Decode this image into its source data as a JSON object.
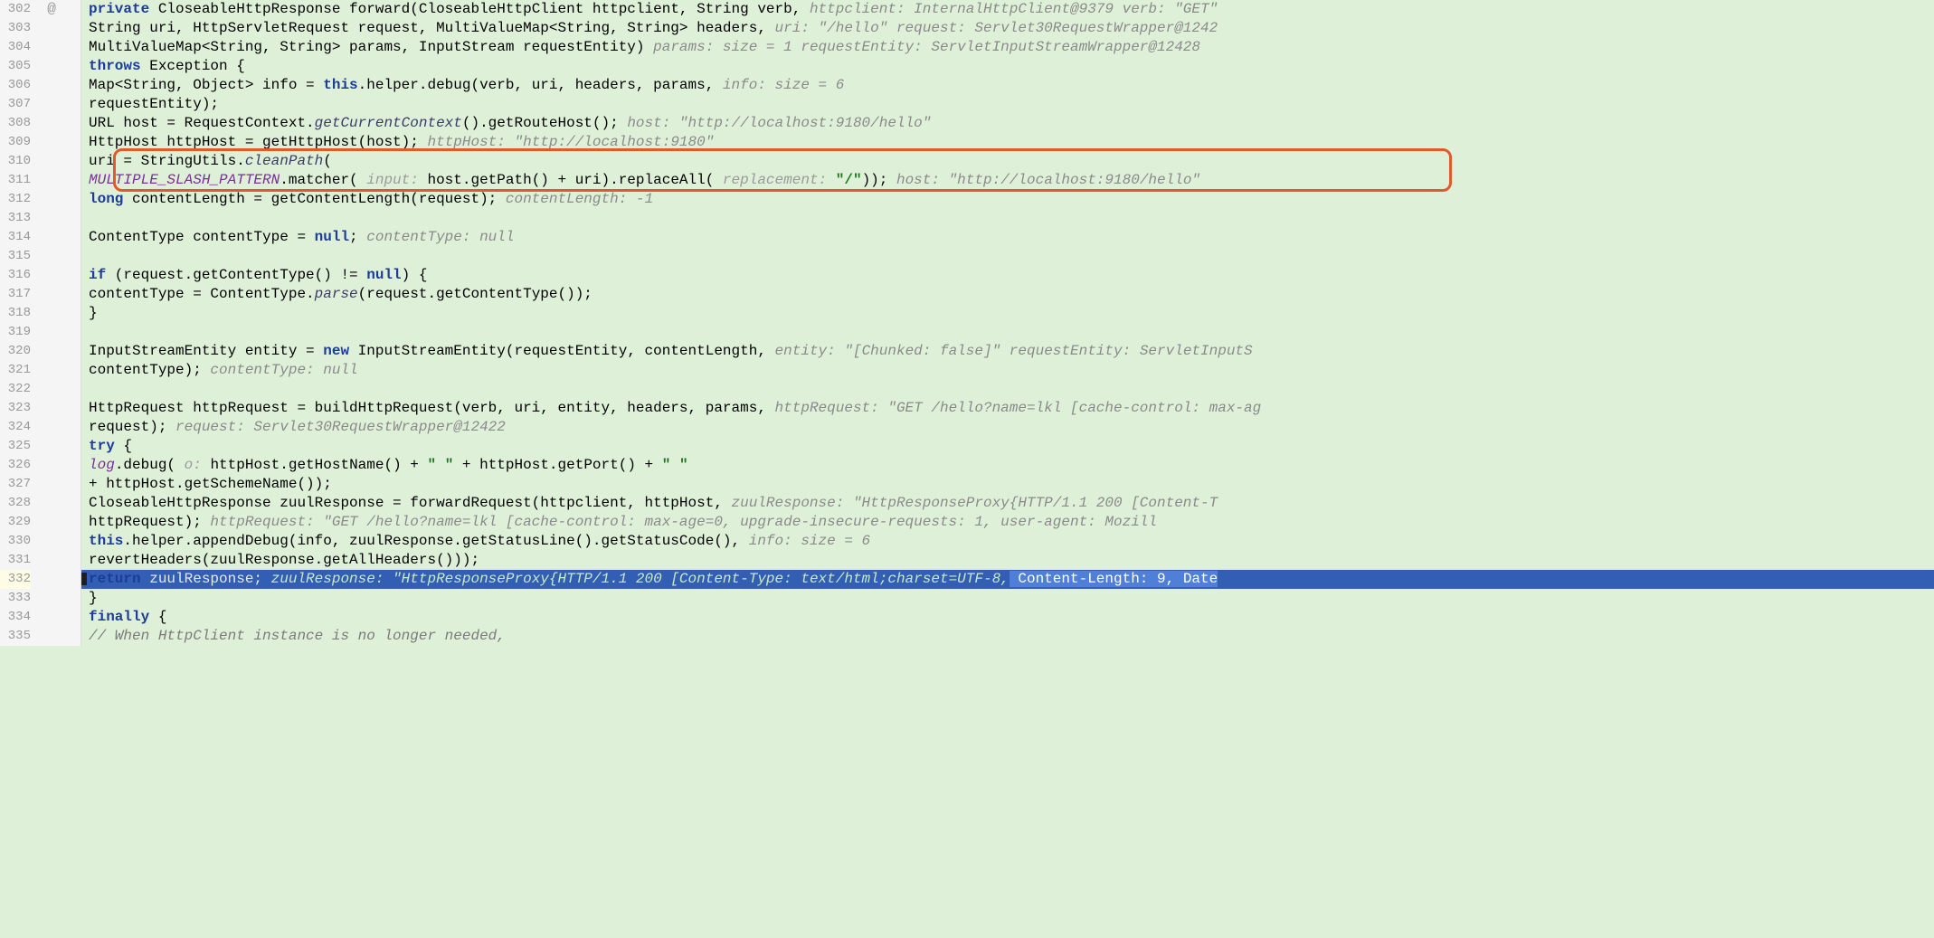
{
  "lines": [
    {
      "n": "302",
      "anno": "@",
      "code": [
        {
          "t": "    ",
          "c": ""
        },
        {
          "t": "private",
          "c": "kw"
        },
        {
          "t": " CloseableHttpResponse forward(CloseableHttpClient httpclient, String verb,   ",
          "c": ""
        },
        {
          "t": "httpclient: InternalHttpClient@9379  verb: \"GET\"",
          "c": "hint"
        }
      ]
    },
    {
      "n": "303",
      "code": [
        {
          "t": "            String uri, HttpServletRequest request, MultiValueMap<String, String> headers,  ",
          "c": ""
        },
        {
          "t": "uri: \"/hello\"  request: Servlet30RequestWrapper@1242",
          "c": "hint"
        }
      ]
    },
    {
      "n": "304",
      "code": [
        {
          "t": "            MultiValueMap<String, String> params, InputStream requestEntity)   ",
          "c": ""
        },
        {
          "t": "params:  size = 1  requestEntity: ServletInputStreamWrapper@12428",
          "c": "hint"
        }
      ]
    },
    {
      "n": "305",
      "code": [
        {
          "t": "            ",
          "c": ""
        },
        {
          "t": "throws",
          "c": "kw"
        },
        {
          "t": " Exception {",
          "c": ""
        }
      ]
    },
    {
      "n": "306",
      "code": [
        {
          "t": "        Map<String, Object> info = ",
          "c": ""
        },
        {
          "t": "this",
          "c": "kw"
        },
        {
          "t": ".helper.debug(verb, uri, headers, params,   ",
          "c": ""
        },
        {
          "t": "info:  size = 6",
          "c": "hint"
        }
      ]
    },
    {
      "n": "307",
      "code": [
        {
          "t": "                requestEntity);",
          "c": ""
        }
      ]
    },
    {
      "n": "308",
      "code": [
        {
          "t": "        URL host = RequestContext.",
          "c": ""
        },
        {
          "t": "getCurrentContext",
          "c": "method-call"
        },
        {
          "t": "().getRouteHost();   ",
          "c": ""
        },
        {
          "t": "host: \"http://localhost:9180/hello\"",
          "c": "hint"
        }
      ]
    },
    {
      "n": "309",
      "code": [
        {
          "t": "        HttpHost httpHost = getHttpHost(host);   ",
          "c": ""
        },
        {
          "t": "httpHost: \"http://localhost:9180\"",
          "c": "hint"
        }
      ]
    },
    {
      "n": "310",
      "code": [
        {
          "t": "        uri = StringUtils.",
          "c": ""
        },
        {
          "t": "cleanPath",
          "c": "method-call"
        },
        {
          "t": "(",
          "c": ""
        }
      ]
    },
    {
      "n": "311",
      "code": [
        {
          "t": "                ",
          "c": ""
        },
        {
          "t": "MULTIPLE_SLASH_PATTERN",
          "c": "const-ref"
        },
        {
          "t": ".matcher( ",
          "c": ""
        },
        {
          "t": "input: ",
          "c": "hint-label"
        },
        {
          "t": "host.getPath() + uri).replaceAll( ",
          "c": ""
        },
        {
          "t": "replacement: ",
          "c": "hint-label"
        },
        {
          "t": "\"/\"",
          "c": "str"
        },
        {
          "t": "));   ",
          "c": ""
        },
        {
          "t": "host: \"http://localhost:9180/hello\"",
          "c": "hint"
        }
      ]
    },
    {
      "n": "312",
      "code": [
        {
          "t": "        ",
          "c": ""
        },
        {
          "t": "long",
          "c": "kw"
        },
        {
          "t": " contentLength = getContentLength(request);   ",
          "c": ""
        },
        {
          "t": "contentLength: -1",
          "c": "hint"
        }
      ]
    },
    {
      "n": "313",
      "code": [
        {
          "t": "",
          "c": ""
        }
      ]
    },
    {
      "n": "314",
      "code": [
        {
          "t": "        ContentType contentType = ",
          "c": ""
        },
        {
          "t": "null",
          "c": "kw"
        },
        {
          "t": ";   ",
          "c": ""
        },
        {
          "t": "contentType: null",
          "c": "hint"
        }
      ]
    },
    {
      "n": "315",
      "code": [
        {
          "t": "",
          "c": ""
        }
      ]
    },
    {
      "n": "316",
      "code": [
        {
          "t": "        ",
          "c": ""
        },
        {
          "t": "if",
          "c": "kw"
        },
        {
          "t": " (request.getContentType() != ",
          "c": ""
        },
        {
          "t": "null",
          "c": "kw"
        },
        {
          "t": ") {",
          "c": ""
        }
      ]
    },
    {
      "n": "317",
      "code": [
        {
          "t": "            contentType = ContentType.",
          "c": ""
        },
        {
          "t": "parse",
          "c": "method-call"
        },
        {
          "t": "(request.getContentType());",
          "c": ""
        }
      ]
    },
    {
      "n": "318",
      "code": [
        {
          "t": "        }",
          "c": ""
        }
      ]
    },
    {
      "n": "319",
      "code": [
        {
          "t": "",
          "c": ""
        }
      ]
    },
    {
      "n": "320",
      "code": [
        {
          "t": "        InputStreamEntity entity = ",
          "c": ""
        },
        {
          "t": "new",
          "c": "kw"
        },
        {
          "t": " InputStreamEntity(requestEntity, contentLength,   ",
          "c": ""
        },
        {
          "t": "entity: \"[Chunked: false]\"  requestEntity: ServletInputS",
          "c": "hint"
        }
      ]
    },
    {
      "n": "321",
      "code": [
        {
          "t": "                contentType);   ",
          "c": ""
        },
        {
          "t": "contentType: null",
          "c": "hint"
        }
      ]
    },
    {
      "n": "322",
      "code": [
        {
          "t": "",
          "c": ""
        }
      ]
    },
    {
      "n": "323",
      "code": [
        {
          "t": "        HttpRequest httpRequest = buildHttpRequest(verb, uri, entity, headers, params,   ",
          "c": ""
        },
        {
          "t": "httpRequest: \"GET /hello?name=lkl [cache-control: max-ag",
          "c": "hint"
        }
      ]
    },
    {
      "n": "324",
      "code": [
        {
          "t": "                request);   ",
          "c": ""
        },
        {
          "t": "request: Servlet30RequestWrapper@12422",
          "c": "hint"
        }
      ]
    },
    {
      "n": "325",
      "code": [
        {
          "t": "        ",
          "c": ""
        },
        {
          "t": "try",
          "c": "kw"
        },
        {
          "t": " {",
          "c": ""
        }
      ]
    },
    {
      "n": "326",
      "code": [
        {
          "t": "            ",
          "c": ""
        },
        {
          "t": "log",
          "c": "const-ref"
        },
        {
          "t": ".debug( ",
          "c": ""
        },
        {
          "t": "o: ",
          "c": "hint-label"
        },
        {
          "t": "httpHost.getHostName() + ",
          "c": ""
        },
        {
          "t": "\" \"",
          "c": "str"
        },
        {
          "t": " + httpHost.getPort() + ",
          "c": ""
        },
        {
          "t": "\" \"",
          "c": "str"
        }
      ]
    },
    {
      "n": "327",
      "code": [
        {
          "t": "                    + httpHost.getSchemeName());",
          "c": ""
        }
      ]
    },
    {
      "n": "328",
      "code": [
        {
          "t": "            CloseableHttpResponse zuulResponse = forwardRequest(httpclient, httpHost,   ",
          "c": ""
        },
        {
          "t": "zuulResponse: \"HttpResponseProxy{HTTP/1.1 200  [Content-T",
          "c": "hint"
        }
      ]
    },
    {
      "n": "329",
      "code": [
        {
          "t": "                    httpRequest);   ",
          "c": ""
        },
        {
          "t": "httpRequest: \"GET /hello?name=lkl [cache-control: max-age=0, upgrade-insecure-requests: 1, user-agent: Mozill",
          "c": "hint"
        }
      ]
    },
    {
      "n": "330",
      "code": [
        {
          "t": "            ",
          "c": ""
        },
        {
          "t": "this",
          "c": "kw"
        },
        {
          "t": ".helper.appendDebug(info, zuulResponse.getStatusLine().getStatusCode(),   ",
          "c": ""
        },
        {
          "t": "info:  size = 6",
          "c": "hint"
        }
      ]
    },
    {
      "n": "331",
      "code": [
        {
          "t": "                    revertHeaders(zuulResponse.getAllHeaders()));",
          "c": ""
        }
      ]
    },
    {
      "n": "332",
      "current": true,
      "code": [
        {
          "t": "            ",
          "c": ""
        },
        {
          "t": "return",
          "c": "kw"
        },
        {
          "t": " zuulResponse;   ",
          "c": ""
        },
        {
          "t": "zuulResponse: \"HttpResponseProxy{HTTP/1.1 200  [Content-Type: text/html;charset=UTF-8,",
          "c": "hint"
        },
        {
          "t": " Content-Length: 9, Date",
          "c": "hint-sel"
        }
      ]
    },
    {
      "n": "333",
      "code": [
        {
          "t": "        }",
          "c": ""
        }
      ]
    },
    {
      "n": "334",
      "code": [
        {
          "t": "        ",
          "c": ""
        },
        {
          "t": "finally",
          "c": "kw"
        },
        {
          "t": " {",
          "c": ""
        }
      ]
    },
    {
      "n": "335",
      "code": [
        {
          "t": "            ",
          "c": ""
        },
        {
          "t": "// When HttpClient instance is no longer needed,",
          "c": "comment"
        }
      ]
    }
  ],
  "highlight_box": {
    "top_line": 310,
    "bottom_line": 311
  }
}
